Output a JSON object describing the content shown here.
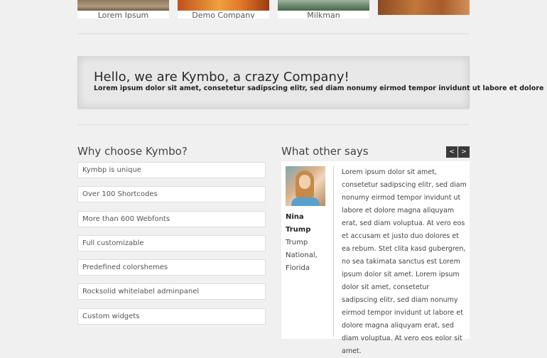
{
  "portfolio": {
    "items": [
      {
        "caption": "Lorem Ipsum"
      },
      {
        "caption": "Demo Company"
      },
      {
        "caption": "Milkman"
      },
      {
        "caption": ""
      }
    ]
  },
  "hero": {
    "title": "Hello, we are Kymbo, a crazy Company!",
    "subtitle": "Lorem ipsum dolor sit amet, consetetur sadipscing elitr, sed diam nonumy eirmod tempor invidunt ut labore et dolore"
  },
  "why": {
    "title": "Why choose Kymbo?",
    "items": [
      "Kymbp is unique",
      "Over 100 Shortcodes",
      "More than 600 Webfonts",
      "Full customizable",
      "Predefined colorshemes",
      "Rocksolid whitelabel adminpanel",
      "Custom widgets"
    ]
  },
  "testimonials": {
    "title": "What other says",
    "prev_label": "<",
    "next_label": ">",
    "author_name": "Nina Trump",
    "author_company": "Trump National, Florida",
    "quote": "Lorem ipsum dolor sit amet, consetetur sadipscing elitr, sed diam nonumy eirmod tempor invidunt ut labore et dolore magna aliquyam erat, sed diam voluptua. At vero eos et accusam et justo duo dolores et ea rebum. Stet clita kasd gubergren, no sea takimata sanctus est Lorem ipsum dolor sit amet. Lorem ipsum dolor sit amet, consetetur sadipscing elitr, sed diam nonumy eirmod tempor invidunt ut labore et dolore magna aliquyam erat, sed diam voluptua. At vero eos eolor sit amet."
  }
}
